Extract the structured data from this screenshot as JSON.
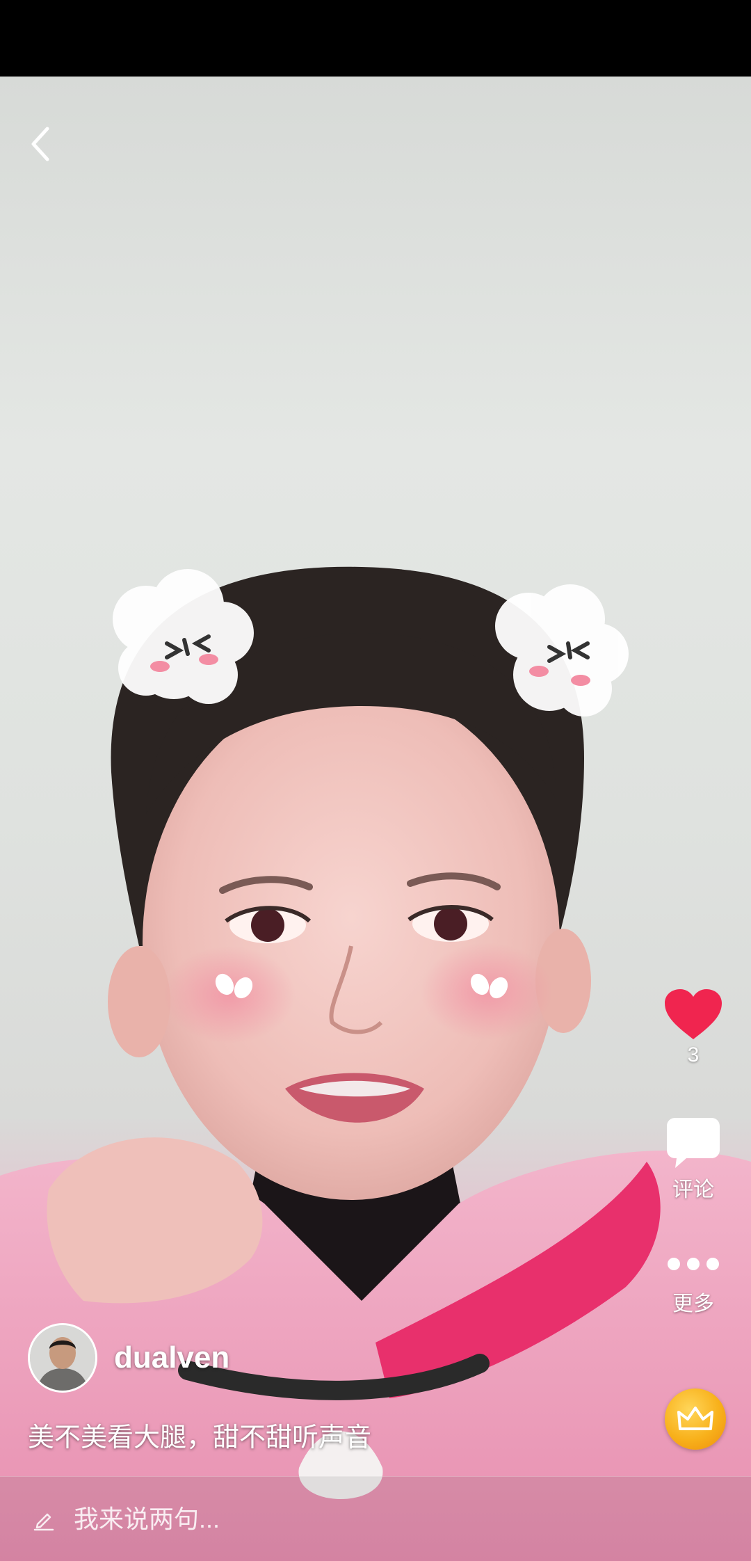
{
  "video": {
    "author": "dualven",
    "caption": "美不美看大腿，甜不甜听声音"
  },
  "actions": {
    "like_count": "3",
    "comment_label": "评论",
    "more_label": "更多"
  },
  "comment_bar": {
    "placeholder": "我来说两句..."
  },
  "icons": {
    "back": "chevron-left-icon",
    "like": "heart-icon",
    "comment": "speech-bubble-icon",
    "more": "ellipsis-icon",
    "vip": "crown-icon",
    "write": "pencil-icon"
  },
  "colors": {
    "like": "#f0254f",
    "crown": "#f8b11b"
  }
}
